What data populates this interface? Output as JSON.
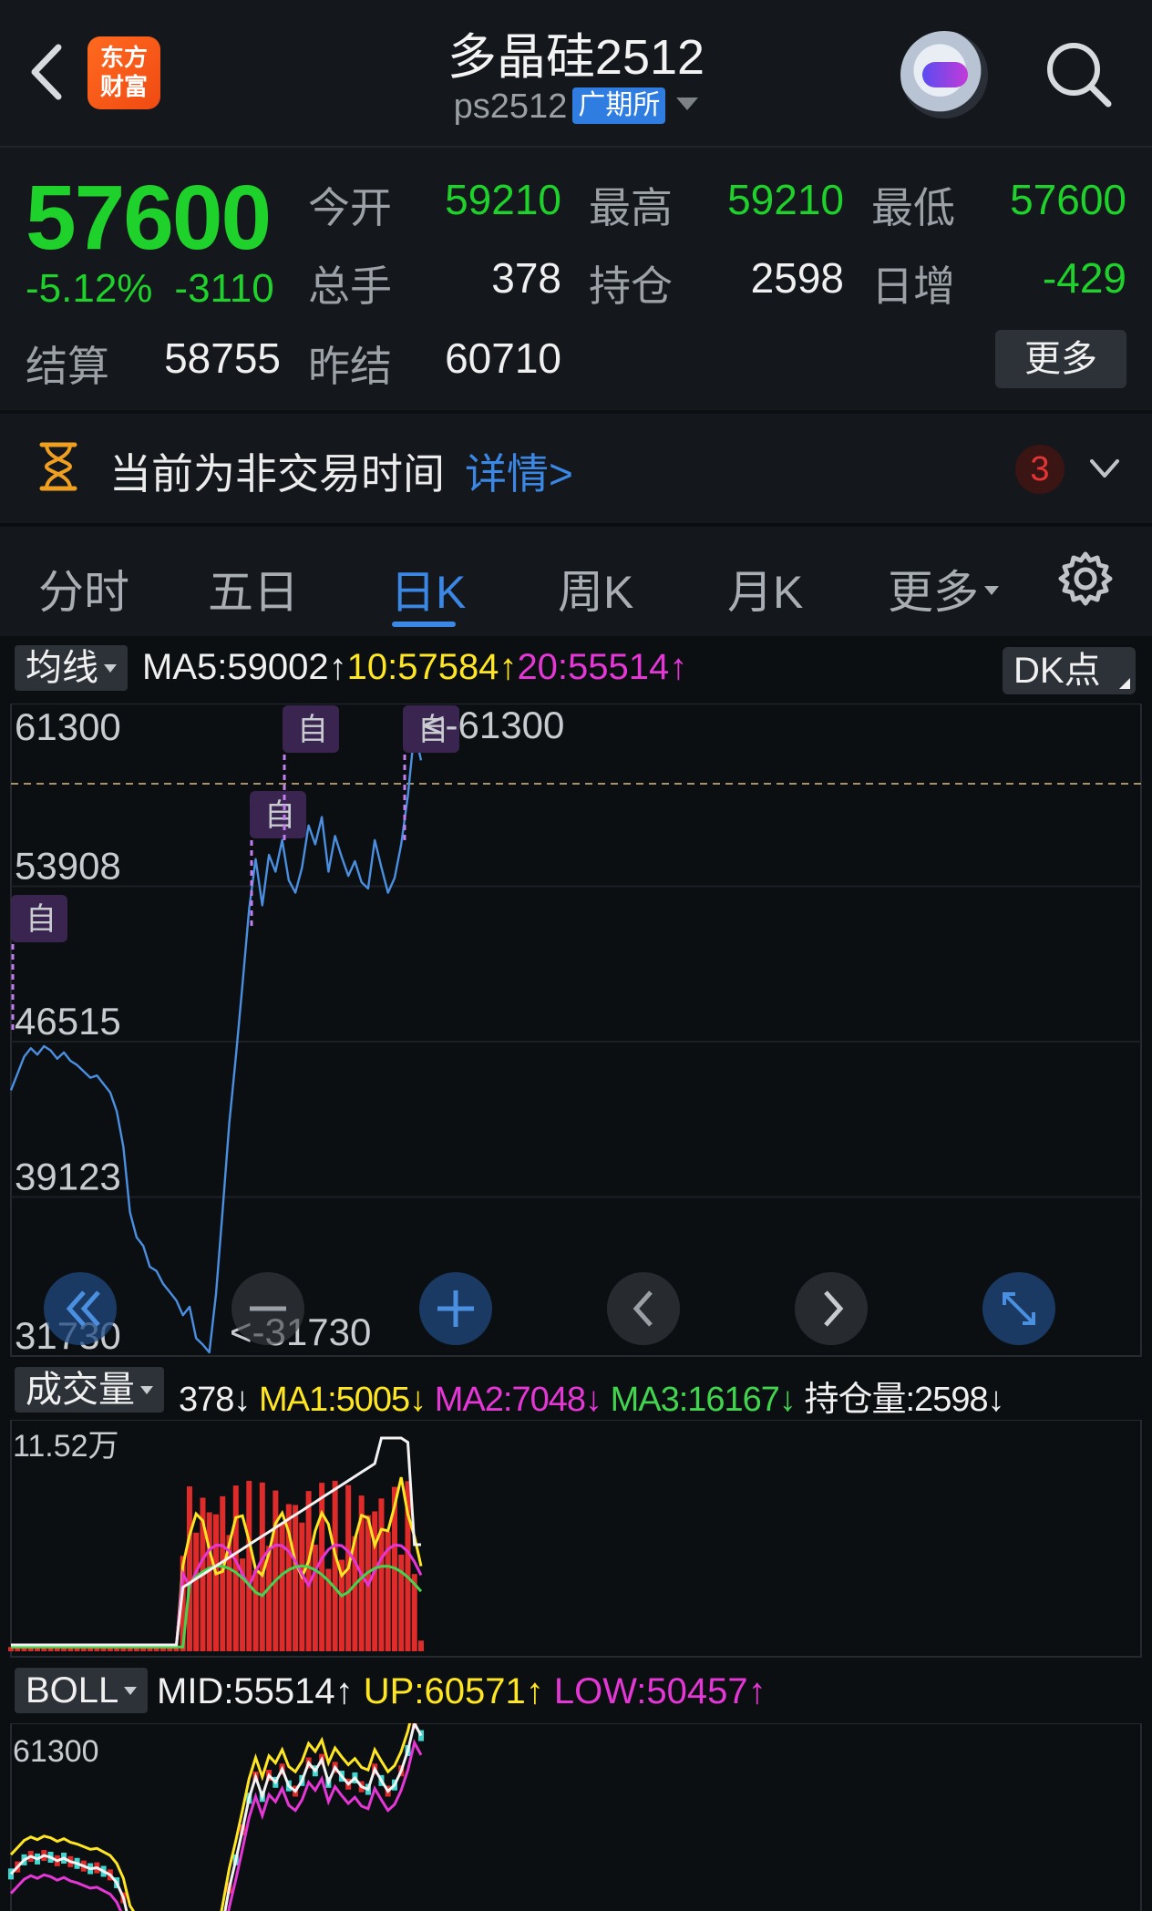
{
  "header": {
    "title": "多晶硅2512",
    "code": "ps2512",
    "exchange": "广期所",
    "logo_line1": "东方",
    "logo_line2": "财富"
  },
  "quote": {
    "price": "57600",
    "change_pct": "-5.12%",
    "change_abs": "-3110",
    "fields": [
      {
        "label": "今开",
        "value": "59210"
      },
      {
        "label": "最高",
        "value": "59210"
      },
      {
        "label": "最低",
        "value": "57600"
      },
      {
        "label": "总手",
        "value": "378"
      },
      {
        "label": "持仓",
        "value": "2598"
      },
      {
        "label": "日增",
        "value": "-429"
      },
      {
        "label": "结算",
        "value": "58755"
      },
      {
        "label": "昨结",
        "value": "60710"
      }
    ],
    "more_label": "更多"
  },
  "notice": {
    "text": "当前为非交易时间",
    "link": "详情>",
    "count": "3"
  },
  "tabs": [
    {
      "label": "分时"
    },
    {
      "label": "五日"
    },
    {
      "label": "日K"
    },
    {
      "label": "周K"
    },
    {
      "label": "月K"
    },
    {
      "label": "更多"
    }
  ],
  "ma_bar": {
    "selector": "均线",
    "ma5": "MA5:59002↑",
    "ma10": "10:57584↑",
    "ma20": "20:55514↑",
    "dk_label": "DK点"
  },
  "main_chart": {
    "y_ticks": [
      "61300",
      "53908",
      "46515",
      "39123",
      "31730"
    ],
    "high_label": "<-61300",
    "low_label": "<-31730",
    "marker_label": "自"
  },
  "volume_bar": {
    "selector": "成交量",
    "vol": "378↓",
    "ma1": "MA1:5005↓",
    "ma2": "MA2:7048↓",
    "ma3": "MA3:16167↓",
    "oi": "持仓量:2598↓",
    "y_max_label": "11.52万"
  },
  "boll_bar": {
    "selector": "BOLL",
    "mid": "MID:55514↑",
    "up": "UP:60571↑",
    "low": "LOW:50457↑",
    "y_max_label": "61300"
  },
  "colors": {
    "price_green": "#1fd12b",
    "accent_blue": "#3b87e6",
    "line_blue": "#4a8fe0",
    "ma_yellow": "#ffe622",
    "ma_magenta": "#e536d6",
    "ma_green": "#42d44f",
    "vol_red": "#e02b2b"
  },
  "chart_data": {
    "type": "line",
    "title": "",
    "ylim": [
      31730,
      61300
    ],
    "series": [
      {
        "name": "",
        "values": [
          44200,
          45000,
          45800,
          46200,
          45900,
          46300,
          46100,
          45700,
          46000,
          45600,
          45400,
          45100,
          44800,
          44900,
          44500,
          44100,
          43200,
          41500,
          38400,
          37200,
          36800,
          35800,
          35600,
          35000,
          34600,
          34200,
          33500,
          33900,
          32400,
          32100,
          31730,
          34500,
          38500,
          42600,
          45800,
          49200,
          52800,
          55200,
          53000,
          55400,
          54600,
          56100,
          54200,
          53600,
          54800,
          56800,
          55900,
          57200,
          54600,
          56300,
          55300,
          54400,
          55100,
          54100,
          53800,
          56100,
          54800,
          53600,
          54300,
          55900,
          58200,
          61300,
          59900
        ]
      }
    ]
  }
}
